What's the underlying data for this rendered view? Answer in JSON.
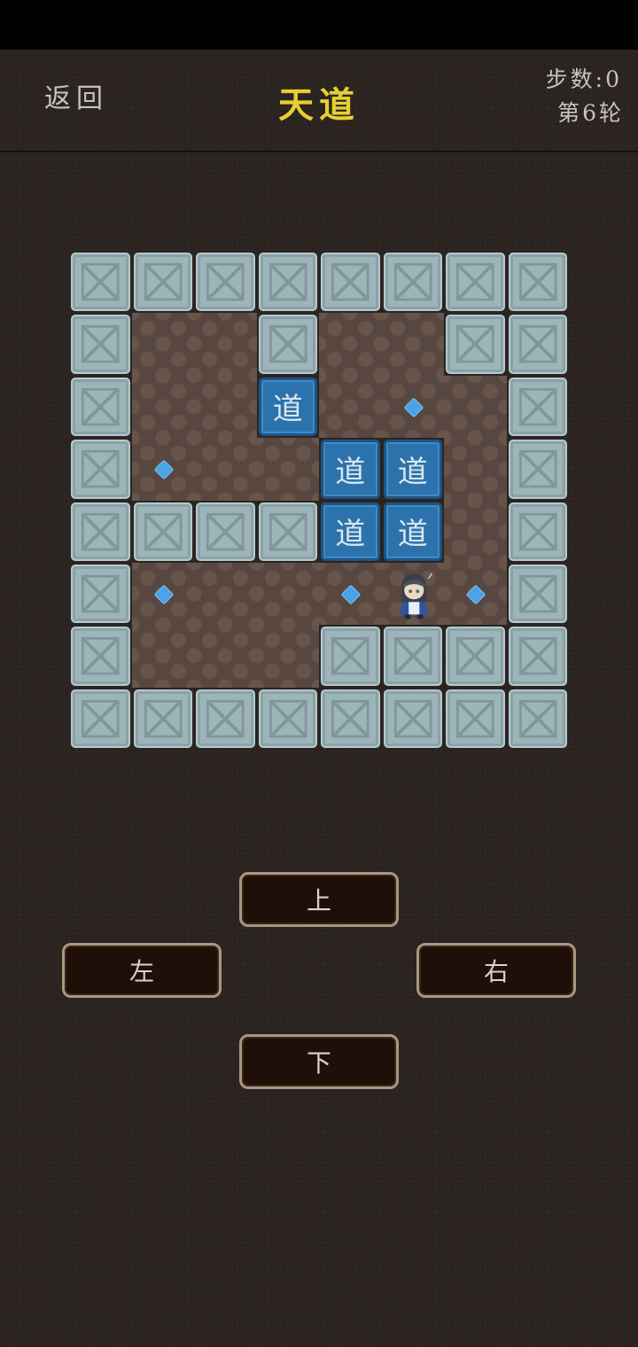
{
  "header": {
    "back_label": "返回",
    "title": "天道",
    "steps_label": "步数:0",
    "round_label": "第6轮"
  },
  "board": {
    "box_label": "道",
    "rows": [
      "########",
      "#  #  ##",
      "#  B . #",
      "#.  BB #",
      "####BB #",
      "#.  .P.#",
      "#   ####",
      "########"
    ],
    "legend": {
      "#": "wall",
      " ": "floor",
      "B": "box",
      ".": "target",
      "P": "player"
    }
  },
  "controls": {
    "up_label": "上",
    "left_label": "左",
    "right_label": "右",
    "down_label": "下"
  },
  "colors": {
    "title": "#e7cf32",
    "wall": "#9db4b9",
    "box": "#2c73ad",
    "target": "#4aa3e6",
    "floor": "#574740"
  }
}
